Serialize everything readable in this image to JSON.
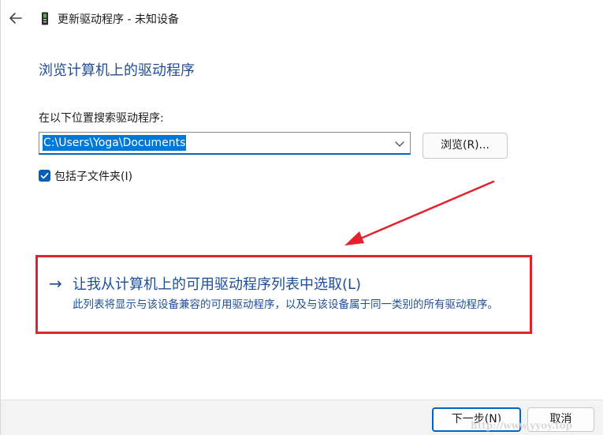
{
  "window": {
    "title": "更新驱动程序 - 未知设备"
  },
  "page": {
    "heading": "浏览计算机上的驱动程序",
    "search_label": "在以下位置搜索驱动程序:",
    "path_value": "C:\\Users\\Yoga\\Documents",
    "browse_label": "浏览(R)...",
    "include_subfolders_label": "包括子文件夹(I)",
    "include_subfolders_checked": true
  },
  "option": {
    "title": "让我从计算机上的可用驱动程序列表中选取(L)",
    "description": "此列表将显示与该设备兼容的可用驱动程序，以及与该设备属于同一类别的所有驱动程序。"
  },
  "footer": {
    "next_label": "下一步(N)",
    "cancel_label": "取消"
  },
  "watermark": "http://www.yyoy.top",
  "icons": {
    "back": "back-arrow-icon",
    "device": "device-icon",
    "dropdown": "chevron-down-icon",
    "checkbox": "checkmark-icon",
    "option_arrow": "arrow-right-icon",
    "annotation": "red-arrow-annotation"
  },
  "colors": {
    "accent": "#0067c0",
    "link_blue": "#1f4e96",
    "annotation_red": "#e3232b",
    "selection": "#0078d7"
  }
}
